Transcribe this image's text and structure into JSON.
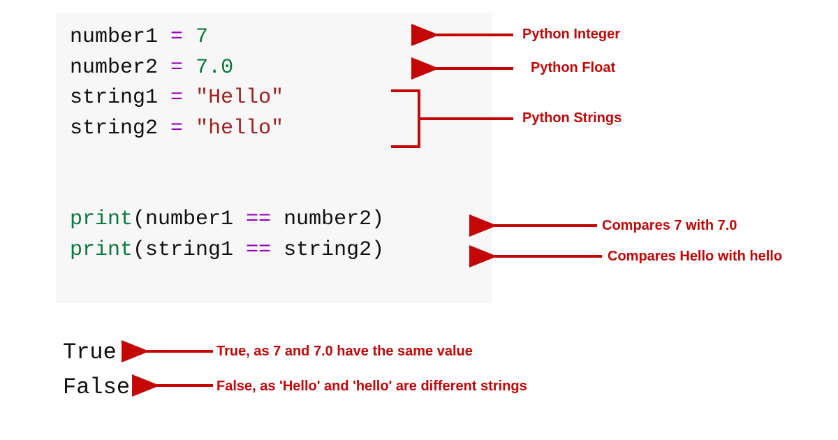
{
  "code": {
    "line1": {
      "var": "number1",
      "assign": "=",
      "val": "7"
    },
    "line2": {
      "var": "number2",
      "assign": "=",
      "val": "7.0"
    },
    "line3": {
      "var": "string1",
      "assign": "=",
      "val": "\"Hello\""
    },
    "line4": {
      "var": "string2",
      "assign": "=",
      "val": "\"hello\""
    },
    "line6": {
      "func": "print",
      "open": "(",
      "a": "number1",
      "cmp": "==",
      "b": "number2",
      "close": ")"
    },
    "line7": {
      "func": "print",
      "open": "(",
      "a": "string1",
      "cmp": "==",
      "b": "string2",
      "close": ")"
    }
  },
  "output": {
    "r1": "True",
    "r2": "False"
  },
  "annotations": {
    "int": "Python Integer",
    "float": "Python Float",
    "strings": "Python Strings",
    "cmp1": "Compares 7 with 7.0",
    "cmp2": "Compares Hello with hello",
    "out1": "True, as 7 and 7.0 have the same value",
    "out2": "False, as 'Hello' and 'hello' are different strings"
  },
  "colors": {
    "annotation_red": "#c40606",
    "code_bg": "#f7f7f7",
    "operator": "#9a00c0",
    "number_and_func": "#0a7a3a",
    "string": "#a02020"
  }
}
